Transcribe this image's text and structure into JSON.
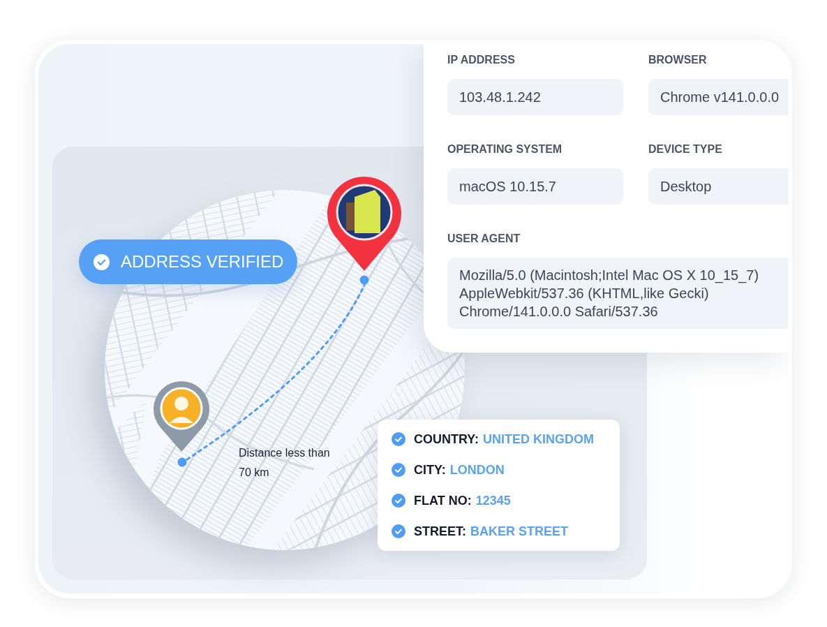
{
  "device_info": {
    "fields": [
      {
        "kind": "text",
        "label": "IP ADDRESS",
        "value": "103.48.1.242"
      },
      {
        "kind": "text",
        "label": "BROWSER",
        "value": "Chrome v141.0.0.0"
      },
      {
        "kind": "text",
        "label": "OPERATING SYSTEM",
        "value": "macOS 10.15.7"
      },
      {
        "kind": "text",
        "label": "DEVICE TYPE",
        "value": "Desktop"
      },
      {
        "kind": "textarea",
        "label": "USER AGENT",
        "value": "Mozilla/5.0 (Macintosh;Intel Mac OS X 10_15_7) AppleWebkit/537.36 (KHTML,like Gecki) Chrome/141.0.0.0 Safari/537.36"
      }
    ]
  },
  "map": {
    "badge": {
      "label": "ADDRESS VERIFIED"
    },
    "distance_label": "Distance less than 70 km"
  },
  "address_details": {
    "items": [
      {
        "label": "COUNTRY:",
        "value": "UNITED KINGDOM"
      },
      {
        "label": "CITY:",
        "value": "LONDON"
      },
      {
        "label": "FLAT NO:",
        "value": "12345"
      },
      {
        "label": "STREET:",
        "value": "BAKER STREET"
      }
    ]
  }
}
